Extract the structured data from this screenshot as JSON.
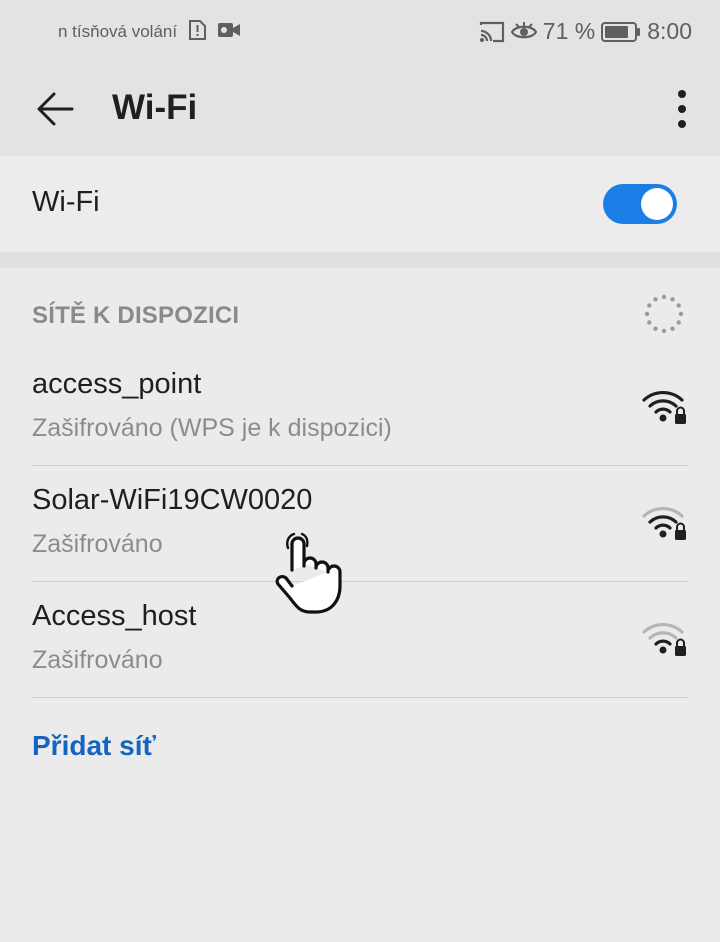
{
  "status_bar": {
    "carrier_text": "n tísňová volání",
    "battery_percent": "71 %",
    "time": "8:00",
    "icons": [
      "alert-sim-icon",
      "video-icon",
      "cast-icon",
      "eye-icon",
      "battery-icon"
    ]
  },
  "app_bar": {
    "title": "Wi-Fi",
    "back_icon": "arrow-back-icon",
    "more_icon": "more-vert-icon"
  },
  "wifi_toggle": {
    "label": "Wi-Fi",
    "enabled": true,
    "accent_color": "#1a7ee6"
  },
  "available": {
    "title": "SÍTĚ K DISPOZICI",
    "networks": [
      {
        "name": "access_point",
        "security": "Zašifrováno (WPS je k dispozici)",
        "signal": "strong"
      },
      {
        "name": "Solar-WiFi19CW0020",
        "security": "Zašifrováno",
        "signal": "medium"
      },
      {
        "name": "Access_host",
        "security": "Zašifrováno",
        "signal": "weak"
      }
    ]
  },
  "add_network_label": "Přidat síť",
  "link_color": "#1565c0"
}
